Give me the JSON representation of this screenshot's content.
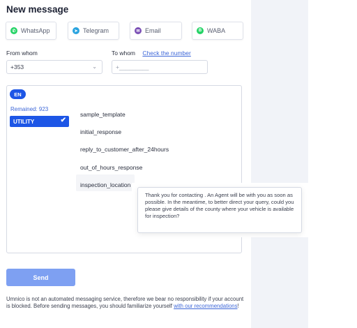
{
  "title": "New message",
  "channels": [
    {
      "label": "WhatsApp",
      "icon": "whatsapp-icon",
      "color": "#25d366",
      "glyph": "✆"
    },
    {
      "label": "Telegram",
      "icon": "telegram-icon",
      "color": "#2aa3df",
      "glyph": "➤"
    },
    {
      "label": "Email",
      "icon": "email-icon",
      "color": "#7a4fb5",
      "glyph": "✉"
    },
    {
      "label": "WABA",
      "icon": "waba-icon",
      "color": "#25d366",
      "glyph": "B"
    }
  ],
  "from": {
    "label": "From whom",
    "value": "+353"
  },
  "to": {
    "label": "To whom",
    "check_link": "Check the number",
    "placeholder": "+_________"
  },
  "template_panel": {
    "language": "EN",
    "remained": "Remained: 923",
    "category": "UTILITY",
    "templates": [
      "sample_template",
      "initial_response",
      "reply_to_customer_after_24hours",
      "out_of_hours_response",
      "inspection_location"
    ],
    "tooltip": "Thank you for contacting                      . An Agent will be with you as soon as possible. In the meantime, to better direct your query, could you please give details of the county where your vehicle is available for inspection?"
  },
  "send_label": "Send",
  "disclaimer": {
    "text": "Umnico is not an automated messaging service, therefore we bear no responsibility if your account is blocked. Before sending messages, you should familiarize yourself ",
    "link": "with our recommendations",
    "end": "!"
  },
  "colors": {
    "accent": "#1d56e6",
    "send_button": "#7ea0f2",
    "link": "#3d67d8"
  }
}
